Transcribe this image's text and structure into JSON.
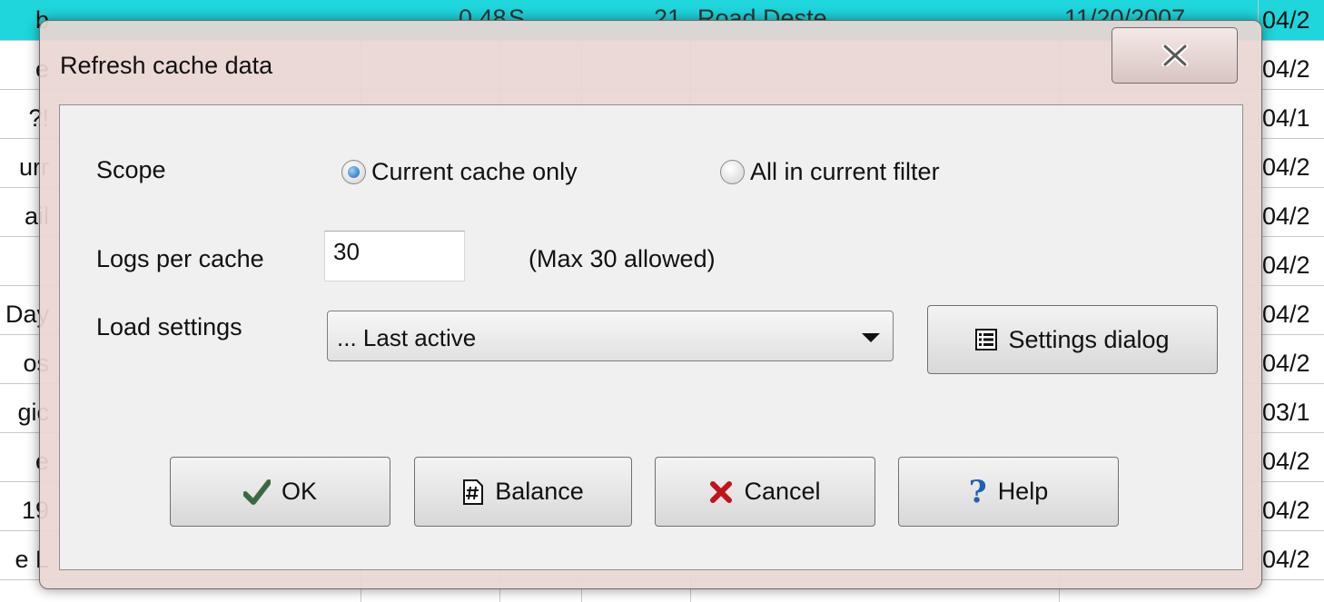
{
  "background": {
    "left_fragments": [
      "b",
      "e",
      "?!",
      "urr",
      "ail",
      "",
      "Day",
      "os",
      "gic",
      "e",
      "19",
      "e L"
    ],
    "right_dates": [
      "04/2",
      "04/2",
      "04/1",
      "04/2",
      "04/2",
      "04/2",
      "04/2",
      "04/2",
      "03/1",
      "04/2",
      "04/2",
      "04/2"
    ],
    "top_row_texts": [
      "0.48",
      "S",
      "21",
      "Road Deste",
      "11/20/2007"
    ]
  },
  "dialog": {
    "title": "Refresh cache data",
    "scope": {
      "label": "Scope",
      "options": [
        "Current cache only",
        "All in current filter"
      ],
      "selected": "Current cache only"
    },
    "logs": {
      "label": "Logs per cache",
      "value": "30",
      "note": "(Max 30 allowed)"
    },
    "load_settings": {
      "label": "Load settings",
      "selected": "... Last active",
      "settings_button": "Settings dialog"
    },
    "buttons": {
      "ok": "OK",
      "balance": "Balance",
      "cancel": "Cancel",
      "help": "Help"
    }
  },
  "colors": {
    "selected_row": "#1ed6dc",
    "dialog_frame": "#e8d6d2",
    "client_area": "#f0f0f0",
    "ok_check": "#3f6f2a",
    "cancel_x": "#c0141a",
    "help_q": "#1f5fb8"
  },
  "icons": {
    "close": "close-icon",
    "settings": "list-icon",
    "ok": "checkmark-icon",
    "balance": "hash-document-icon",
    "cancel": "x-icon",
    "help": "question-icon"
  }
}
